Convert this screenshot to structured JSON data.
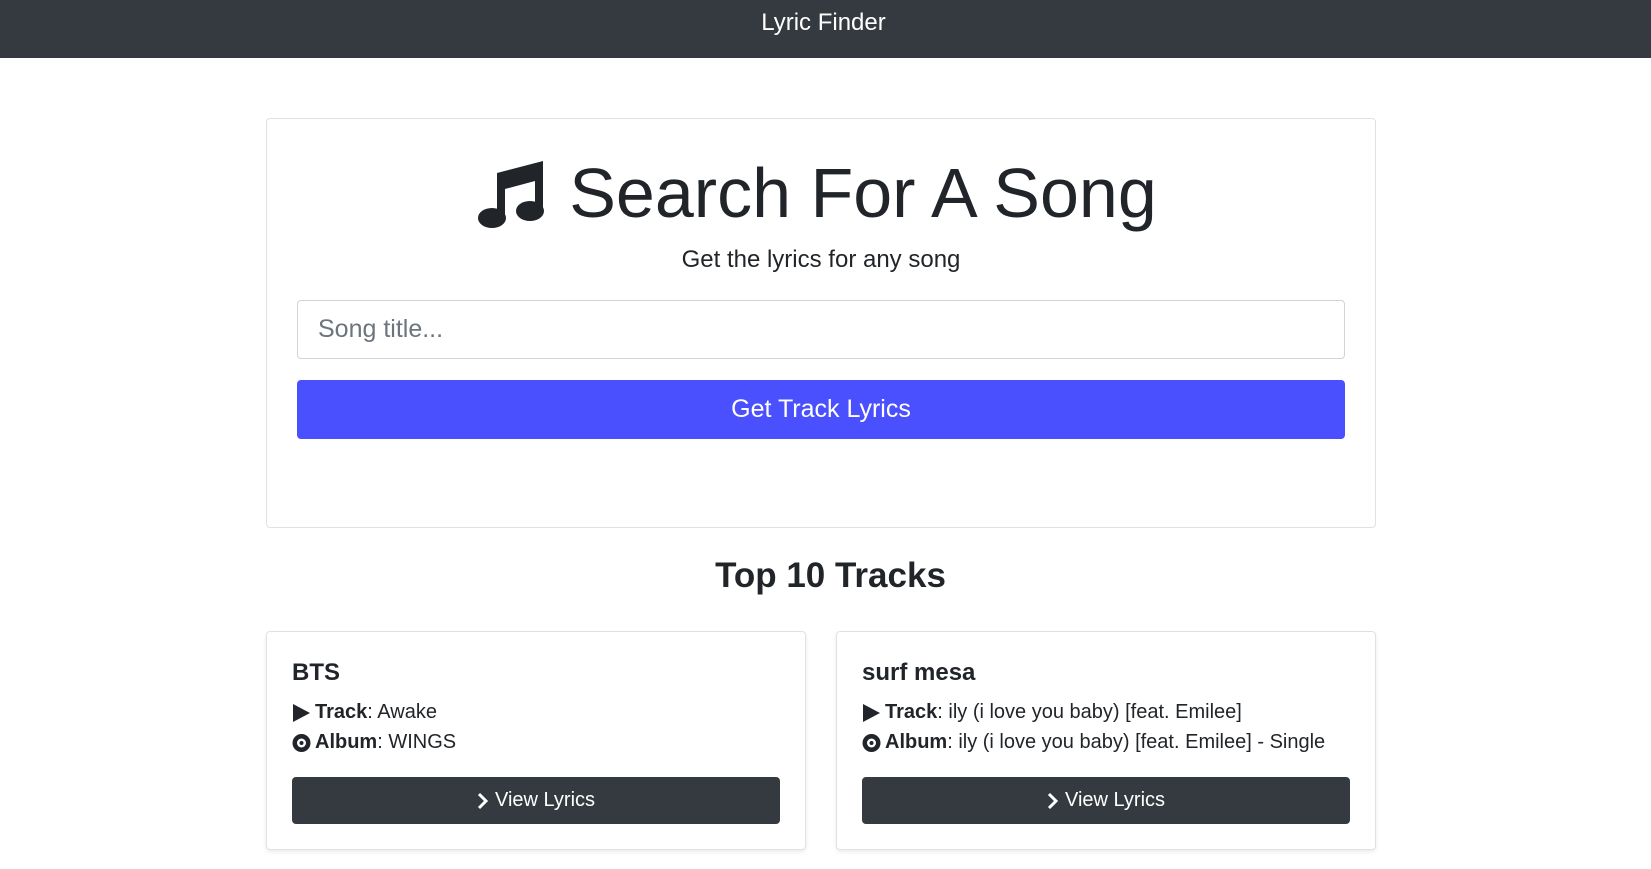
{
  "navbar": {
    "brand": "Lyric Finder"
  },
  "search": {
    "icon": "music-note-icon",
    "title": "Search For A Song",
    "subtitle": "Get the lyrics for any song",
    "input_value": "",
    "input_placeholder": "Song title...",
    "button_label": "Get Track Lyrics",
    "button_color": "#4b50ff"
  },
  "tracks_section": {
    "title": "Top 10 Tracks",
    "tracks": [
      {
        "artist": "BTS",
        "track_label": "Track",
        "track_value": ": Awake",
        "album_label": "Album",
        "album_value": ": WINGS",
        "button_label": "View Lyrics"
      },
      {
        "artist": "surf mesa",
        "track_label": "Track",
        "track_value": ": ily (i love you baby) [feat. Emilee]",
        "album_label": "Album",
        "album_value": ": ily (i love you baby) [feat. Emilee] - Single",
        "button_label": "View Lyrics"
      }
    ]
  },
  "colors": {
    "navbar": "#343a40",
    "primary_button": "#4b50ff",
    "dark_button": "#343a40"
  }
}
